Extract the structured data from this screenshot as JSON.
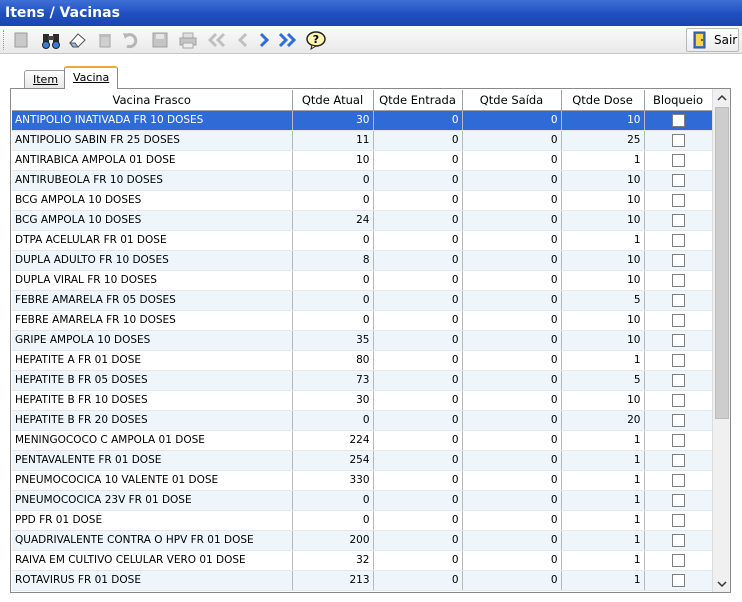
{
  "window": {
    "title": "Itens / Vacinas"
  },
  "toolbar": {
    "exit_label": "Sair"
  },
  "tabs": [
    {
      "label": "Item"
    },
    {
      "label": "Vacina"
    }
  ],
  "table": {
    "columns": [
      "Vacina Frasco",
      "Qtde Atual",
      "Qtde Entrada",
      "Qtde Saída",
      "Qtde Dose",
      "Bloqueio"
    ],
    "rows": [
      {
        "name": "ANTIPOLIO INATIVADA FR 10 DOSES",
        "atual": "30",
        "entrada": "0",
        "saida": "0",
        "dose": "10",
        "bloqueio": false,
        "selected": true
      },
      {
        "name": "ANTIPOLIO SABIN FR 25 DOSES",
        "atual": "11",
        "entrada": "0",
        "saida": "0",
        "dose": "25",
        "bloqueio": false
      },
      {
        "name": "ANTIRABICA AMPOLA 01 DOSE",
        "atual": "10",
        "entrada": "0",
        "saida": "0",
        "dose": "1",
        "bloqueio": false
      },
      {
        "name": "ANTIRUBEOLA FR 10 DOSES",
        "atual": "0",
        "entrada": "0",
        "saida": "0",
        "dose": "10",
        "bloqueio": false
      },
      {
        "name": "BCG AMPOLA 10 DOSES",
        "atual": "0",
        "entrada": "0",
        "saida": "0",
        "dose": "10",
        "bloqueio": false
      },
      {
        "name": "BCG AMPOLA 10 DOSES",
        "atual": "24",
        "entrada": "0",
        "saida": "0",
        "dose": "10",
        "bloqueio": false
      },
      {
        "name": "DTPA ACELULAR FR 01 DOSE",
        "atual": "0",
        "entrada": "0",
        "saida": "0",
        "dose": "1",
        "bloqueio": false
      },
      {
        "name": "DUPLA ADULTO FR 10 DOSES",
        "atual": "8",
        "entrada": "0",
        "saida": "0",
        "dose": "10",
        "bloqueio": false
      },
      {
        "name": "DUPLA VIRAL FR 10 DOSES",
        "atual": "0",
        "entrada": "0",
        "saida": "0",
        "dose": "10",
        "bloqueio": false
      },
      {
        "name": "FEBRE AMARELA FR 05 DOSES",
        "atual": "0",
        "entrada": "0",
        "saida": "0",
        "dose": "5",
        "bloqueio": false
      },
      {
        "name": "FEBRE AMARELA FR 10 DOSES",
        "atual": "0",
        "entrada": "0",
        "saida": "0",
        "dose": "10",
        "bloqueio": false
      },
      {
        "name": "GRIPE AMPOLA 10 DOSES",
        "atual": "35",
        "entrada": "0",
        "saida": "0",
        "dose": "10",
        "bloqueio": false
      },
      {
        "name": "HEPATITE A FR 01 DOSE",
        "atual": "80",
        "entrada": "0",
        "saida": "0",
        "dose": "1",
        "bloqueio": false
      },
      {
        "name": "HEPATITE B FR 05 DOSES",
        "atual": "73",
        "entrada": "0",
        "saida": "0",
        "dose": "5",
        "bloqueio": false
      },
      {
        "name": "HEPATITE B FR 10 DOSES",
        "atual": "30",
        "entrada": "0",
        "saida": "0",
        "dose": "10",
        "bloqueio": false
      },
      {
        "name": "HEPATITE B FR 20 DOSES",
        "atual": "0",
        "entrada": "0",
        "saida": "0",
        "dose": "20",
        "bloqueio": false
      },
      {
        "name": "MENINGOCOCO C AMPOLA 01 DOSE",
        "atual": "224",
        "entrada": "0",
        "saida": "0",
        "dose": "1",
        "bloqueio": false
      },
      {
        "name": "PENTAVALENTE FR 01 DOSE",
        "atual": "254",
        "entrada": "0",
        "saida": "0",
        "dose": "1",
        "bloqueio": false
      },
      {
        "name": "PNEUMOCOCICA 10 VALENTE 01 DOSE",
        "atual": "330",
        "entrada": "0",
        "saida": "0",
        "dose": "1",
        "bloqueio": false
      },
      {
        "name": "PNEUMOCOCICA 23V  FR 01 DOSE",
        "atual": "0",
        "entrada": "0",
        "saida": "0",
        "dose": "1",
        "bloqueio": false
      },
      {
        "name": "PPD FR 01 DOSE",
        "atual": "0",
        "entrada": "0",
        "saida": "0",
        "dose": "1",
        "bloqueio": false
      },
      {
        "name": "QUADRIVALENTE CONTRA O HPV FR 01 DOSE",
        "atual": "200",
        "entrada": "0",
        "saida": "0",
        "dose": "1",
        "bloqueio": false
      },
      {
        "name": "RAIVA EM  CULTIVO CELULAR VERO 01 DOSE",
        "atual": "32",
        "entrada": "0",
        "saida": "0",
        "dose": "1",
        "bloqueio": false
      },
      {
        "name": "ROTAVIRUS FR 01 DOSE",
        "atual": "213",
        "entrada": "0",
        "saida": "0",
        "dose": "1",
        "bloqueio": false
      }
    ]
  }
}
